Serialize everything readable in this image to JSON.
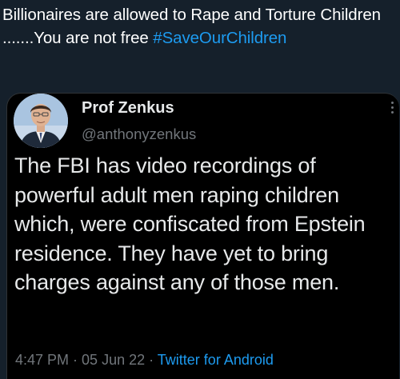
{
  "post": {
    "text_part1": "Billionaires are allowed to Rape and Torture Children .......You are not free ",
    "hashtag": "#SaveOurChildren"
  },
  "quoted_tweet": {
    "display_name": "Prof Zenkus",
    "handle": "@anthonyzenkus",
    "text": "The FBI has video recordings of powerful adult men raping children which, were confiscated from Epstein residence. They have yet to bring charges against any of those men.",
    "time": "4:47 PM",
    "separator": " · ",
    "date": "05 Jun 22",
    "source": "Twitter for Android"
  },
  "colors": {
    "background": "#15202b",
    "card_background": "#000000",
    "accent": "#1d9bf0",
    "secondary_text": "#71767b"
  },
  "icons": {
    "avatar": "profile-photo-man-in-suit",
    "more": "vertical-dots-icon"
  }
}
